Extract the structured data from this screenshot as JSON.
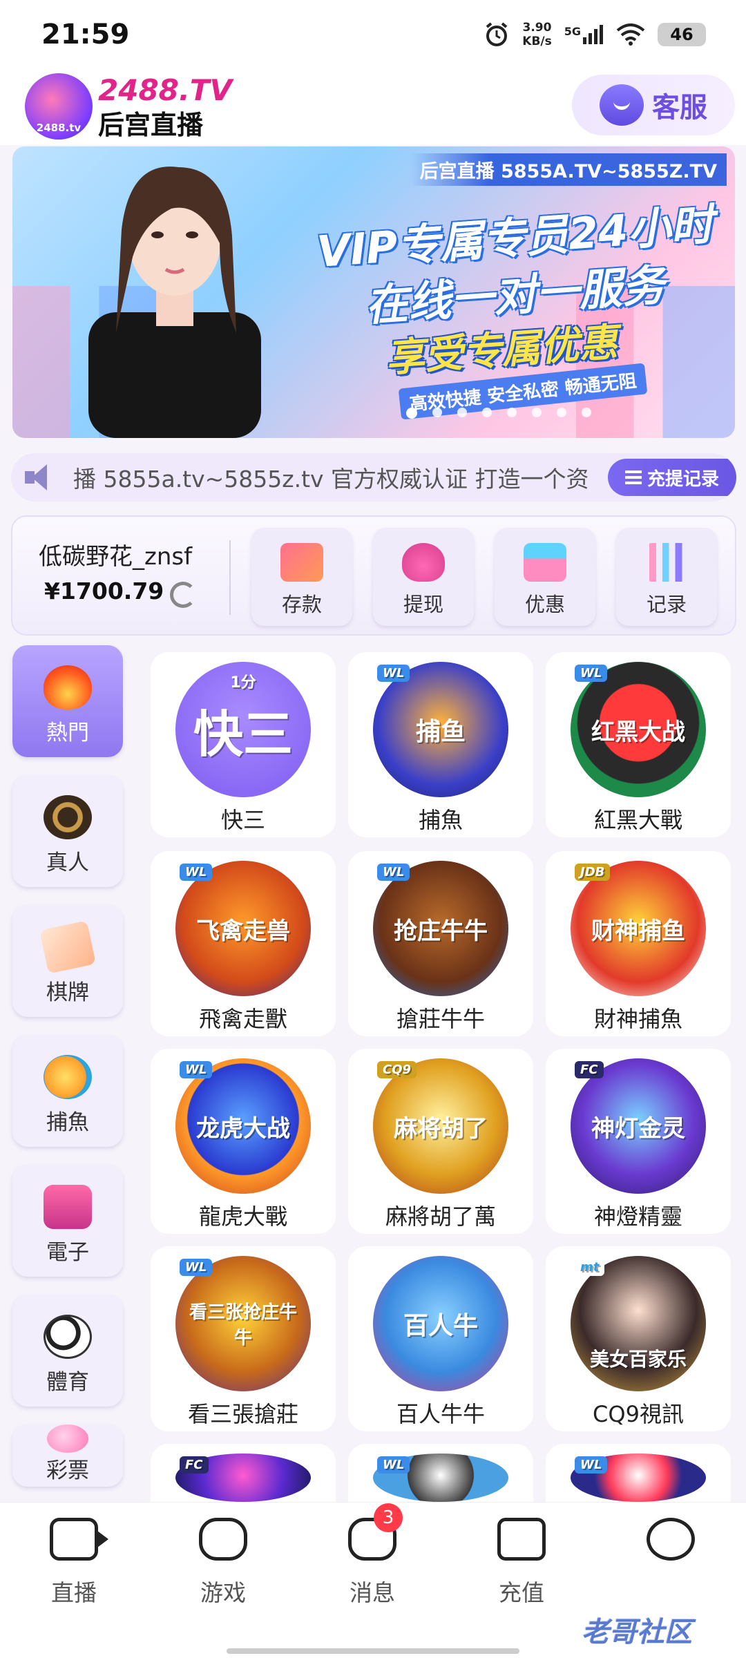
{
  "status_bar": {
    "time": "21:59",
    "speed_value": "3.90",
    "speed_unit": "KB/s",
    "network": "5G",
    "battery": "46"
  },
  "header": {
    "logo_text": "2488.TV",
    "logo_badge_text": "2488.tv",
    "app_name": "后宫直播",
    "service_label": "客服"
  },
  "banner": {
    "tag": "后宫直播 5855A.TV~5855Z.TV",
    "line1": "VIP专属专员24小时",
    "line2": "在线一对一服务",
    "line3": "享受专属优惠",
    "line4": "高效快捷  安全私密  畅通无阻",
    "dot_count": 8,
    "active_dot": 0
  },
  "marquee": {
    "text": "播 5855a.tv~5855z.tv 官方权威认证 打造一个资",
    "record_button": "充提记录"
  },
  "account": {
    "username": "低碳野花_znsf",
    "balance": "¥1700.79",
    "actions": [
      {
        "label": "存款",
        "icon": "card-icon"
      },
      {
        "label": "提现",
        "icon": "money-bag-icon"
      },
      {
        "label": "优惠",
        "icon": "gift-icon"
      },
      {
        "label": "记录",
        "icon": "bar-chart-icon"
      }
    ]
  },
  "categories": [
    {
      "label": "熱門",
      "icon": "fire-icon",
      "active": true
    },
    {
      "label": "真人",
      "icon": "casino-chip-icon",
      "active": false
    },
    {
      "label": "棋牌",
      "icon": "playing-card-icon",
      "active": false
    },
    {
      "label": "捕魚",
      "icon": "fish-icon",
      "active": false
    },
    {
      "label": "電子",
      "icon": "slot-machine-icon",
      "active": false
    },
    {
      "label": "體育",
      "icon": "soccer-ball-icon",
      "active": false
    },
    {
      "label": "彩票",
      "icon": "lottery-ball-icon",
      "active": false
    }
  ],
  "games": [
    {
      "name": "快三",
      "icon_text": "快三",
      "tag": "1分"
    },
    {
      "name": "捕魚",
      "icon_text": "捕鱼",
      "tag": "WL"
    },
    {
      "name": "紅黑大戰",
      "icon_text": "红黑大战",
      "tag": "WL"
    },
    {
      "name": "飛禽走獸",
      "icon_text": "飞禽走兽",
      "tag": "WL"
    },
    {
      "name": "搶莊牛牛",
      "icon_text": "抢庄牛牛",
      "tag": "WL"
    },
    {
      "name": "財神捕魚",
      "icon_text": "财神捕鱼",
      "tag": "JDB"
    },
    {
      "name": "龍虎大戰",
      "icon_text": "龙虎大战",
      "tag": "WL"
    },
    {
      "name": "麻將胡了萬",
      "icon_text": "麻将胡了",
      "tag": "CQ9"
    },
    {
      "name": "神燈精靈",
      "icon_text": "神灯金灵",
      "tag": "FC"
    },
    {
      "name": "看三張搶莊",
      "icon_text": "看三张抢庄牛牛",
      "tag": "WL"
    },
    {
      "name": "百人牛牛",
      "icon_text": "百人牛",
      "tag": ""
    },
    {
      "name": "CQ9視訊",
      "icon_text": "美女百家乐",
      "tag": "mt"
    },
    {
      "name": "",
      "icon_text": "",
      "tag": "FC"
    },
    {
      "name": "",
      "icon_text": "",
      "tag": "WL"
    },
    {
      "name": "",
      "icon_text": "",
      "tag": "WL"
    }
  ],
  "bottom_nav": [
    {
      "label": "直播",
      "icon": "video-camera-icon"
    },
    {
      "label": "游戏",
      "icon": "gamepad-icon"
    },
    {
      "label": "消息",
      "icon": "chat-icon",
      "badge": "3"
    },
    {
      "label": "充值",
      "icon": "wallet-icon"
    },
    {
      "label": "",
      "icon": "smiley-face-icon"
    }
  ],
  "watermark": "老哥社区"
}
